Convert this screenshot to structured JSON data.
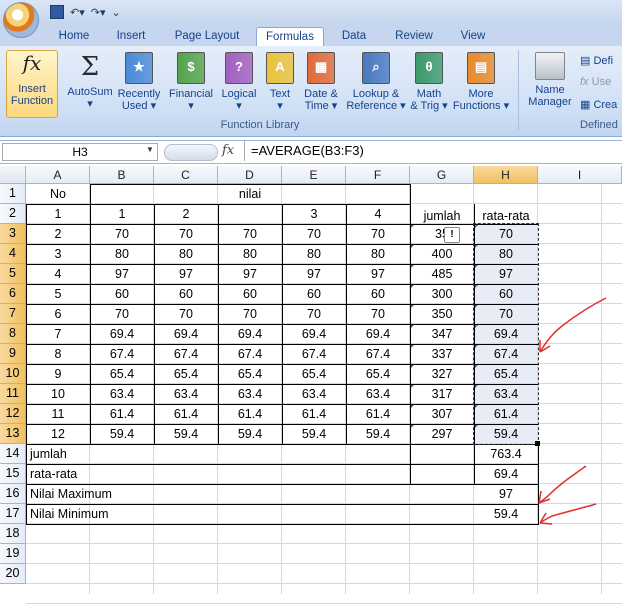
{
  "tabs": [
    "Home",
    "Insert",
    "Page Layout",
    "Formulas",
    "Data",
    "Review",
    "View"
  ],
  "active_tab": "Formulas",
  "ribbon": {
    "insert_function": [
      "Insert",
      "Function"
    ],
    "buttons": [
      {
        "l1": "AutoSum",
        "l2": "▾",
        "icon": "sigma-icon"
      },
      {
        "l1": "Recently",
        "l2": "Used ▾",
        "icon": "recent-book-icon"
      },
      {
        "l1": "Financial",
        "l2": "▾",
        "icon": "financial-book-icon"
      },
      {
        "l1": "Logical",
        "l2": "▾",
        "icon": "logical-book-icon"
      },
      {
        "l1": "Text",
        "l2": "▾",
        "icon": "text-book-icon"
      },
      {
        "l1": "Date &",
        "l2": "Time ▾",
        "icon": "date-time-book-icon"
      },
      {
        "l1": "Lookup &",
        "l2": "Reference ▾",
        "icon": "lookup-book-icon"
      },
      {
        "l1": "Math",
        "l2": "& Trig ▾",
        "icon": "math-book-icon"
      },
      {
        "l1": "More",
        "l2": "Functions ▾",
        "icon": "more-functions-book-icon"
      }
    ],
    "group_label": "Function Library",
    "name_manager": [
      "Name",
      "Manager"
    ],
    "defined_items": [
      "Defi",
      "Use",
      "Crea"
    ],
    "defined_label": "Defined"
  },
  "formula_bar": {
    "name_box": "H3",
    "fx": "fx",
    "formula": "=AVERAGE(B3:F3)"
  },
  "columns": [
    "A",
    "B",
    "C",
    "D",
    "E",
    "F",
    "G",
    "H",
    "I"
  ],
  "selected_column": "H",
  "rows": [
    "1",
    "2",
    "3",
    "4",
    "5",
    "6",
    "7",
    "8",
    "9",
    "10",
    "11",
    "12",
    "13",
    "14",
    "15",
    "16",
    "17",
    "18",
    "19",
    "20"
  ],
  "selected_rows": [
    "3",
    "4",
    "5",
    "6",
    "7",
    "8",
    "9",
    "10",
    "11",
    "12",
    "13"
  ],
  "sheet": {
    "header1": {
      "no": "No",
      "nilai": "nilai"
    },
    "header2": {
      "a": "1",
      "b": "1",
      "c": "2",
      "e": "3",
      "f": "4",
      "g": "jumlah",
      "h": "rata-rata"
    },
    "data_rows": [
      [
        "2",
        "70",
        "70",
        "70",
        "70",
        "70",
        "35",
        "70"
      ],
      [
        "3",
        "80",
        "80",
        "80",
        "80",
        "80",
        "400",
        "80"
      ],
      [
        "4",
        "97",
        "97",
        "97",
        "97",
        "97",
        "485",
        "97"
      ],
      [
        "5",
        "60",
        "60",
        "60",
        "60",
        "60",
        "300",
        "60"
      ],
      [
        "6",
        "70",
        "70",
        "70",
        "70",
        "70",
        "350",
        "70"
      ],
      [
        "7",
        "69.4",
        "69.4",
        "69.4",
        "69.4",
        "69.4",
        "347",
        "69.4"
      ],
      [
        "8",
        "67.4",
        "67.4",
        "67.4",
        "67.4",
        "67.4",
        "337",
        "67.4"
      ],
      [
        "9",
        "65.4",
        "65.4",
        "65.4",
        "65.4",
        "65.4",
        "327",
        "65.4"
      ],
      [
        "10",
        "63.4",
        "63.4",
        "63.4",
        "63.4",
        "63.4",
        "317",
        "63.4"
      ],
      [
        "11",
        "61.4",
        "61.4",
        "61.4",
        "61.4",
        "61.4",
        "307",
        "61.4"
      ],
      [
        "12",
        "59.4",
        "59.4",
        "59.4",
        "59.4",
        "59.4",
        "297",
        "59.4"
      ]
    ],
    "summary": [
      {
        "label": "jumlah",
        "value": "763.4"
      },
      {
        "label": "rata-rata",
        "value": "69.4"
      },
      {
        "label": "Nilai Maximum",
        "value": "97"
      },
      {
        "label": "Nilai Minimum",
        "value": "59.4"
      }
    ]
  },
  "colors": {
    "arrow": "#e03030",
    "selection": "#e8ecf7",
    "header_selected": "#f1c15f"
  }
}
